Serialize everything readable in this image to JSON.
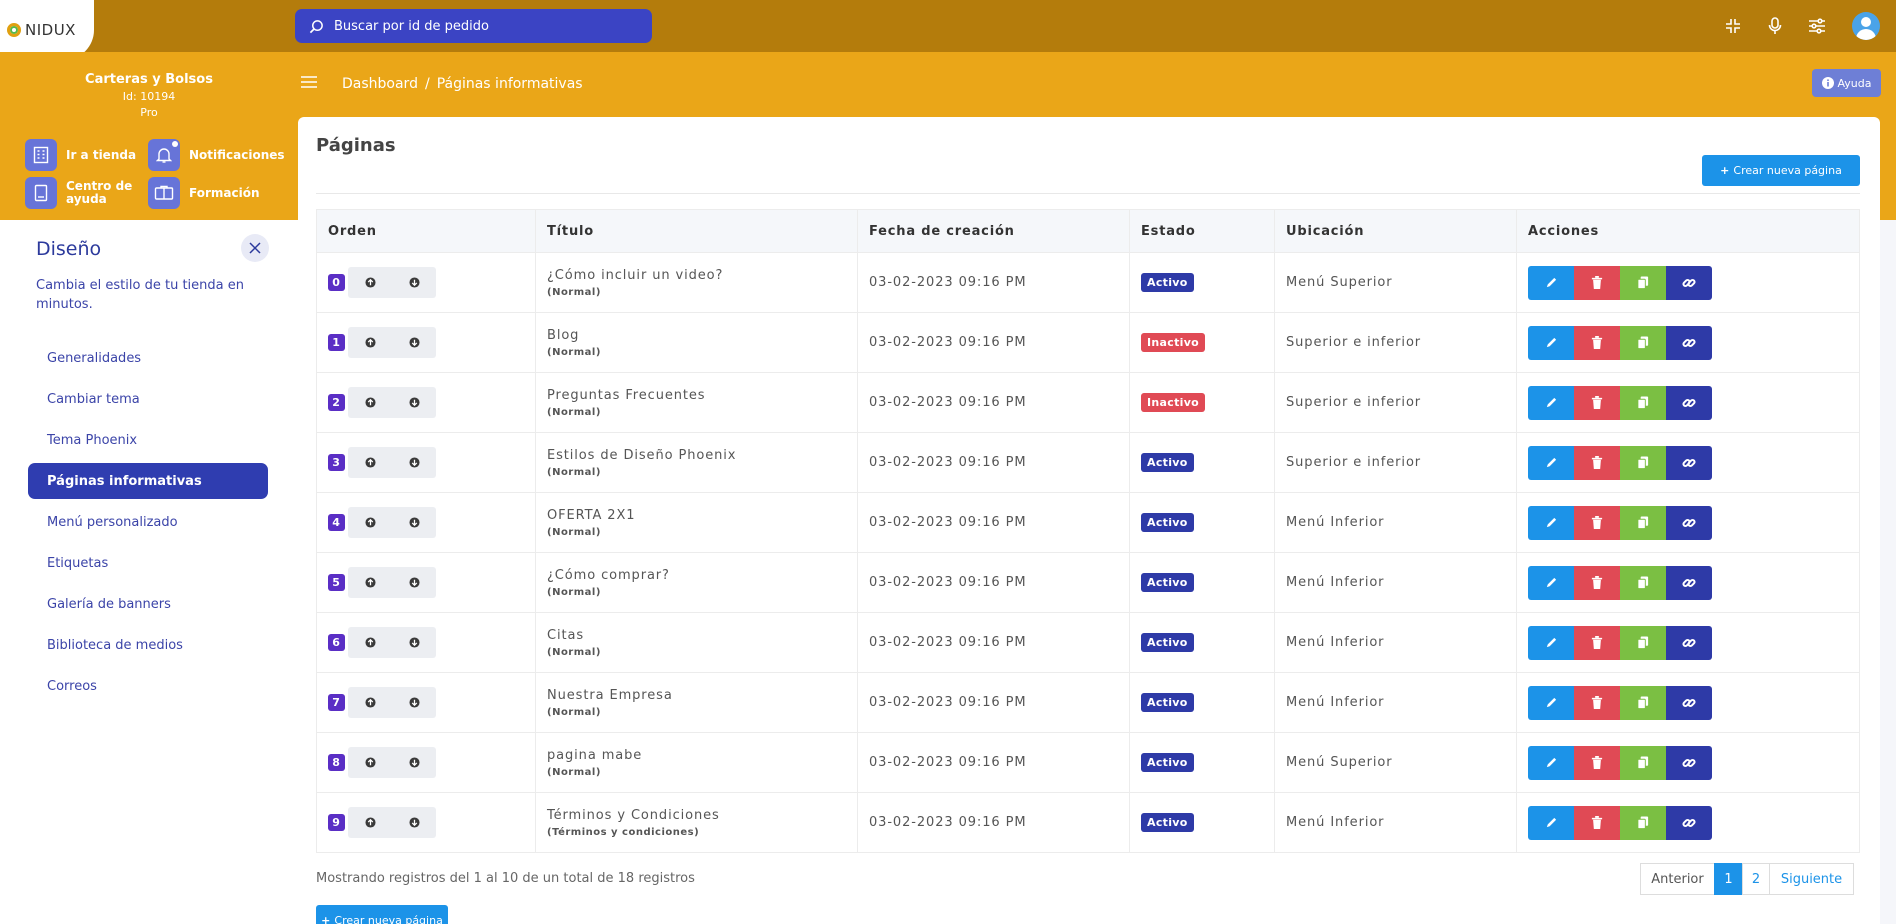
{
  "app": {
    "logo_text": "NIDUX"
  },
  "search": {
    "placeholder": "Buscar por id de pedido"
  },
  "store": {
    "name": "Carteras y Bolsos",
    "id": "Id: 10194",
    "plan": "Pro"
  },
  "quick_links": [
    {
      "label": "Ir a tienda",
      "icon": "store-icon"
    },
    {
      "label": "Notificaciones",
      "icon": "bell-icon"
    },
    {
      "label": "Centro de ayuda",
      "icon": "help-book-icon"
    },
    {
      "label": "Formación",
      "icon": "training-icon"
    }
  ],
  "breadcrumb": {
    "home": "Dashboard",
    "sep": "/",
    "current": "Páginas informativas"
  },
  "help_button": "Ayuda",
  "sidebar": {
    "title": "Diseño",
    "description": "Cambia el estilo de tu tienda en minutos.",
    "items": [
      {
        "label": "Generalidades"
      },
      {
        "label": "Cambiar tema"
      },
      {
        "label": "Tema Phoenix"
      },
      {
        "label": "Páginas informativas",
        "active": true
      },
      {
        "label": "Menú personalizado"
      },
      {
        "label": "Etiquetas"
      },
      {
        "label": "Galería de banners"
      },
      {
        "label": "Biblioteca de medios"
      },
      {
        "label": "Correos"
      }
    ]
  },
  "main": {
    "title": "Páginas",
    "new_button": "Crear nueva página",
    "columns": [
      "Orden",
      "Título",
      "Fecha de creación",
      "Estado",
      "Ubicación",
      "Acciones"
    ],
    "rows": [
      {
        "order": "0",
        "title": "¿Cómo incluir un video?",
        "type": "(Normal)",
        "date": "03-02-2023 09:16 PM",
        "status": "Activo",
        "location": "Menú Superior"
      },
      {
        "order": "1",
        "title": "Blog",
        "type": "(Normal)",
        "date": "03-02-2023 09:16 PM",
        "status": "Inactivo",
        "location": "Superior e inferior"
      },
      {
        "order": "2",
        "title": "Preguntas Frecuentes",
        "type": "(Normal)",
        "date": "03-02-2023 09:16 PM",
        "status": "Inactivo",
        "location": "Superior e inferior"
      },
      {
        "order": "3",
        "title": "Estilos de Diseño Phoenix",
        "type": "(Normal)",
        "date": "03-02-2023 09:16 PM",
        "status": "Activo",
        "location": "Superior e inferior"
      },
      {
        "order": "4",
        "title": "OFERTA 2X1",
        "type": "(Normal)",
        "date": "03-02-2023 09:16 PM",
        "status": "Activo",
        "location": "Menú Inferior"
      },
      {
        "order": "5",
        "title": "¿Cómo comprar?",
        "type": "(Normal)",
        "date": "03-02-2023 09:16 PM",
        "status": "Activo",
        "location": "Menú Inferior"
      },
      {
        "order": "6",
        "title": "Citas",
        "type": "(Normal)",
        "date": "03-02-2023 09:16 PM",
        "status": "Activo",
        "location": "Menú Inferior"
      },
      {
        "order": "7",
        "title": "Nuestra Empresa",
        "type": "(Normal)",
        "date": "03-02-2023 09:16 PM",
        "status": "Activo",
        "location": "Menú Inferior"
      },
      {
        "order": "8",
        "title": "pagina mabe",
        "type": "(Normal)",
        "date": "03-02-2023 09:16 PM",
        "status": "Activo",
        "location": "Menú Superior"
      },
      {
        "order": "9",
        "title": "Términos y Condiciones",
        "type": "(Términos y condiciones)",
        "date": "03-02-2023 09:16 PM",
        "status": "Activo",
        "location": "Menú Inferior"
      }
    ],
    "footer_text": "Mostrando registros del 1 al 10 de un total de 18 registros",
    "pagination": {
      "prev": "Anterior",
      "pages": [
        "1",
        "2"
      ],
      "current": "1",
      "next": "Siguiente"
    },
    "new_button_bottom": "Crear nueva página"
  },
  "colors": {
    "topbar": "#b47c0c",
    "band": "#eaa618",
    "primary": "#2e3aa7",
    "accent": "#1c93e8",
    "danger": "#e04a55",
    "success": "#7bbf43"
  }
}
